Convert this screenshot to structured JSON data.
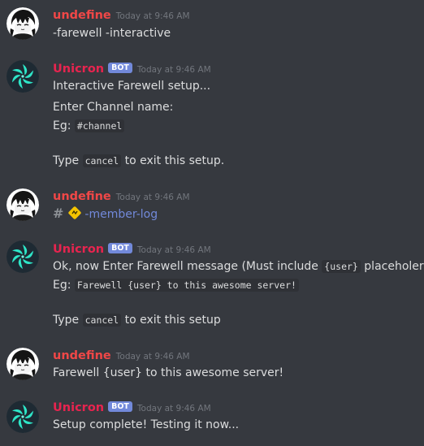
{
  "users": {
    "human": {
      "name": "undefine"
    },
    "bot": {
      "name": "Unicron",
      "tag": "BOT"
    }
  },
  "messages": [
    {
      "author": "undefine",
      "time": "Today at 9:46 AM",
      "lines": [
        "-farewell -interactive"
      ]
    },
    {
      "author": "Unicron",
      "bot": true,
      "time": "Today at 9:46 AM",
      "line1": "Interactive Farewell setup...",
      "line2": "Enter Channel name:",
      "line3_prefix": "Eg: ",
      "line3_code": "#channel",
      "line4_prefix": "Type ",
      "line4_code": "cancel",
      "line4_suffix": " to exit this setup."
    },
    {
      "author": "undefine",
      "time": "Today at 9:46 AM",
      "channel_hash": "#",
      "channel_name": "-member-log"
    },
    {
      "author": "Unicron",
      "bot": true,
      "time": "Today at 9:46 AM",
      "line1_prefix": "Ok, now Enter Farewell message (Must include ",
      "line1_code": "{user}",
      "line1_suffix": " placeholer)",
      "line2_prefix": "Eg: ",
      "line2_code": "Farewell {user} to this awesome server!",
      "line3_prefix": "Type ",
      "line3_code": "cancel",
      "line3_suffix": " to exit this setup"
    },
    {
      "author": "undefine",
      "time": "Today at 9:46 AM",
      "lines": [
        "Farewell {user} to this awesome server!"
      ]
    },
    {
      "author": "Unicron",
      "bot": true,
      "time": "Today at 9:46 AM",
      "lines": [
        "Setup complete! Testing it now..."
      ]
    }
  ],
  "colors": {
    "background": "#36393f",
    "human_name": "#f04747",
    "bot_name": "#e8244f",
    "bot_tag": "#7289da",
    "mention": "#7289da",
    "timestamp": "#72767d"
  },
  "icons": {
    "human_avatar": "anime-character-avatar-icon",
    "bot_avatar": "unicron-logo-icon",
    "channel_emoji": "yellow-diamond-emoji-icon"
  }
}
